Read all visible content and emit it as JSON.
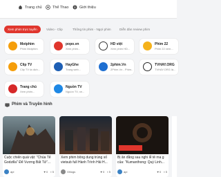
{
  "nav": {
    "items": [
      {
        "label": "Trang chủ",
        "icon": "home-icon"
      },
      {
        "label": "Thể Thao",
        "icon": "soccer-ball-icon"
      },
      {
        "label": "Giới thiệu",
        "icon": "info-icon"
      }
    ]
  },
  "tabs": [
    {
      "label": "Xem phim trực tuyến",
      "active": true
    },
    {
      "label": "Video - Clip",
      "active": false
    },
    {
      "label": "Thông tin phim - Ngợi phim",
      "active": false
    },
    {
      "label": "Diễn đàn review phim",
      "active": false
    }
  ],
  "sites": [
    {
      "name": "Motphim",
      "sub": "Phim Motphim",
      "color": "#f59e0b"
    },
    {
      "name": "popo.vn",
      "sub": "Xem phim...",
      "color": "#e0362d"
    },
    {
      "name": "HD việt",
      "sub": "Xem phim HD...",
      "color": "#333333"
    },
    {
      "name": "Phim 22",
      "sub": "Phim 22 xem...",
      "color": "#f5b21b"
    },
    {
      "name": "Clip TV",
      "sub": "Clip TV là dịch...",
      "color": "#f59e0b"
    },
    {
      "name": "HayGhe",
      "sub": "Trang web...",
      "color": "#1e5fb4"
    },
    {
      "name": "2phim.Vn",
      "sub": "2Phim.Vn - Phim...",
      "color": "#1f6fd1"
    },
    {
      "name": "TVHAY.ORG",
      "sub": "TVHAY.ORG là...",
      "color": "#222222"
    },
    {
      "name": "Trang chủ",
      "sub": "Xem phim...",
      "color": "#d62828"
    },
    {
      "name": "Nguồn TV",
      "sub": "Nguồn TV, xe...",
      "color": "#1e88e5"
    }
  ],
  "section": {
    "title": "Phim và Truyền hình"
  },
  "videos": [
    {
      "title": "Cuộc chiến quái vật: \"Chúa Tể Godzilla\" Để Vương Bất Tử\"...",
      "channel": "api",
      "likes": "0",
      "comments": "5"
    },
    {
      "title": "Xem phim bông dung trùng số vietsub full Hành Trình Hải H...",
      "channel": "Vblogs",
      "likes": "0",
      "comments": "5"
    },
    {
      "title": "Bị ăn đằng sau nghi lễ tẻ ma g của: \"Kumanthong: Quỷ Linh...",
      "channel": "api",
      "likes": "0",
      "comments": "5"
    }
  ]
}
